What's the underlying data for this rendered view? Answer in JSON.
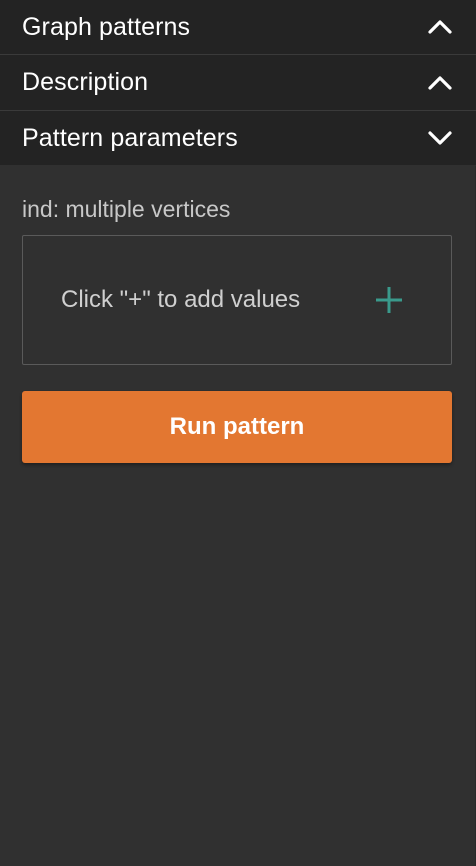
{
  "accordion": {
    "sections": [
      {
        "title": "Graph patterns",
        "state": "expanded",
        "chevron": "chevron-up-icon"
      },
      {
        "title": "Description",
        "state": "expanded",
        "chevron": "chevron-up-icon"
      },
      {
        "title": "Pattern parameters",
        "state": "collapsed",
        "chevron": "chevron-down-icon"
      }
    ]
  },
  "parameters": {
    "label": "ind: multiple vertices",
    "placeholder": "Click \"+\" to add values",
    "add_icon": "plus-icon"
  },
  "actions": {
    "run_label": "Run pattern"
  },
  "colors": {
    "background": "#303030",
    "header_bg": "#232323",
    "accent_button": "#e37731",
    "plus_icon": "#3a9a8c"
  }
}
